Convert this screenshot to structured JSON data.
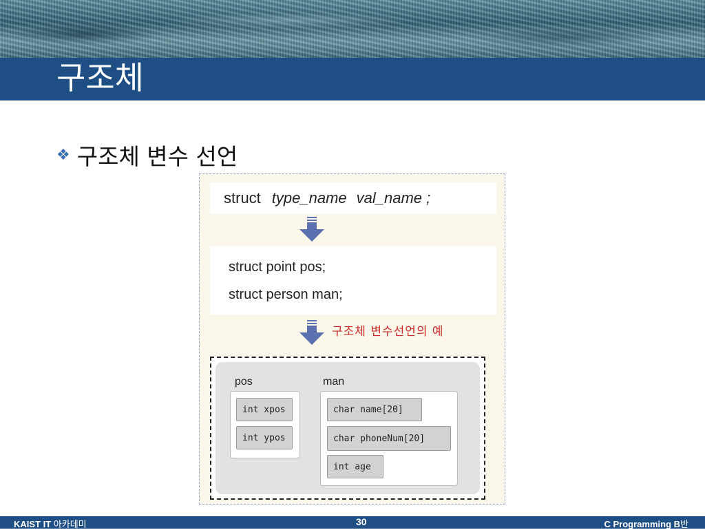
{
  "slide": {
    "title": "구조체",
    "bullet": {
      "icon": "diamond-bullet-icon",
      "text": "구조체 변수 선언"
    }
  },
  "figure": {
    "syntax": {
      "keyword": "struct",
      "type_name": "type_name",
      "val_name": "val_name ;"
    },
    "examples": [
      "struct point pos;",
      "struct person man;"
    ],
    "caption": "구조체 변수선언의 예",
    "diagram": {
      "pos": {
        "label": "pos",
        "members": [
          "int xpos",
          "int ypos"
        ]
      },
      "man": {
        "label": "man",
        "members": [
          "char name[20]",
          "char phoneNum[20]",
          "int age"
        ]
      }
    }
  },
  "footer": {
    "left_bold": "KAIST IT",
    "left_light": " 아카데미",
    "page_number": "30",
    "right_bold": "C Programming B",
    "right_light": "반"
  },
  "colors": {
    "title_bar": "#1f4e84",
    "caption": "#cc2a2a",
    "arrow": "#5c72b0"
  }
}
